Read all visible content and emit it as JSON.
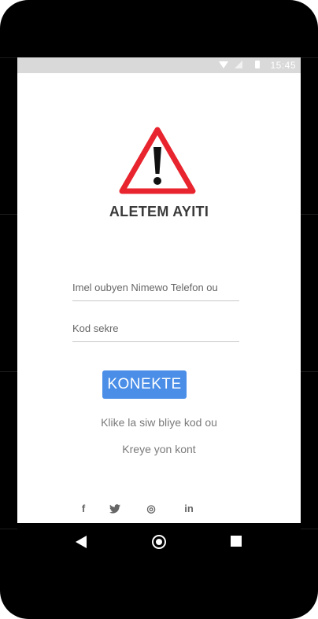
{
  "statusbar": {
    "time": "15:45"
  },
  "app": {
    "title": "ALETEM AYITI"
  },
  "form": {
    "email_placeholder": "Imel oubyen Nimewo Telefon ou",
    "password_placeholder": "Kod sekre",
    "connect_label": "KONEKTE"
  },
  "links": {
    "forgot_password": "Klike la siw bliye kod ou",
    "create_account": "Kreye yon kont"
  },
  "social": {
    "facebook_glyph": "f",
    "instagram_glyph": "◎",
    "linkedin_glyph": "in"
  },
  "colors": {
    "accent": "#4a8ee8",
    "warning_red": "#e8242e"
  },
  "icons": [
    "wifi-icon",
    "signal-icon",
    "battery-icon",
    "warning-icon",
    "facebook-icon",
    "twitter-icon",
    "instagram-icon",
    "linkedin-icon",
    "back-icon",
    "home-icon",
    "recents-icon"
  ]
}
